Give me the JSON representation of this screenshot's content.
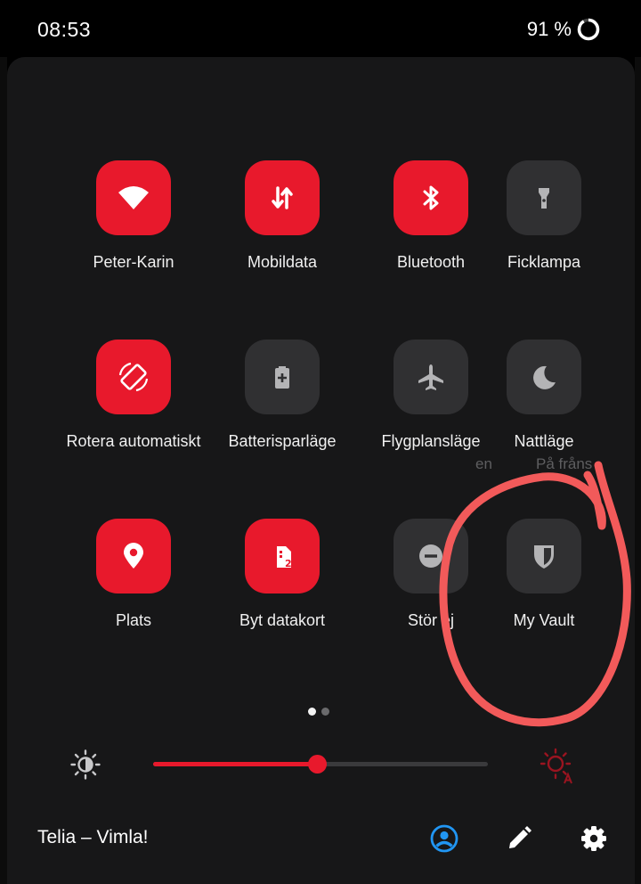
{
  "status_bar": {
    "time": "08:53",
    "battery_percent": "91 %",
    "battery_level": 0.91
  },
  "tiles": [
    {
      "label": "Peter-Karin",
      "icon": "wifi-icon",
      "state": "on"
    },
    {
      "label": "Mobildata",
      "icon": "mobile-data-icon",
      "state": "on"
    },
    {
      "label": "Bluetooth",
      "icon": "bluetooth-icon",
      "state": "on"
    },
    {
      "label": "Ficklampa",
      "icon": "flashlight-icon",
      "state": "off"
    },
    {
      "label": "Rotera automatiskt",
      "icon": "auto-rotate-icon",
      "state": "on"
    },
    {
      "label": "Batterisparläge",
      "icon": "battery-saver-icon",
      "state": "off"
    },
    {
      "label": "Flygplansläge",
      "icon": "airplane-icon",
      "state": "off"
    },
    {
      "label": "Nattläge",
      "icon": "moon-icon",
      "state": "off"
    },
    {
      "label": "Plats",
      "icon": "location-icon",
      "state": "on"
    },
    {
      "label": "Byt datakort",
      "icon": "sim-card-2-icon",
      "state": "on"
    },
    {
      "label": "Stör ej",
      "icon": "do-not-disturb-icon",
      "state": "off"
    },
    {
      "label": "My Vault",
      "icon": "shield-icon",
      "state": "off"
    }
  ],
  "background_text": {
    "fragment_1": "en",
    "fragment_2": "På fråns"
  },
  "page_indicator": {
    "pages": 2,
    "current": 1
  },
  "brightness": {
    "level_percent": 49,
    "brightness_icon": "brightness-icon",
    "auto_icon": "auto-brightness-icon"
  },
  "footer": {
    "carrier": "Telia – Vimla!",
    "user_icon": "user-account-icon",
    "edit_icon": "edit-pencil-icon",
    "settings_icon": "gear-icon"
  },
  "colors": {
    "accent": "#e8192c",
    "tile_off": "#303032",
    "panel": "#171718",
    "user_icon": "#2196f3",
    "annotation": "#f25a5a"
  }
}
